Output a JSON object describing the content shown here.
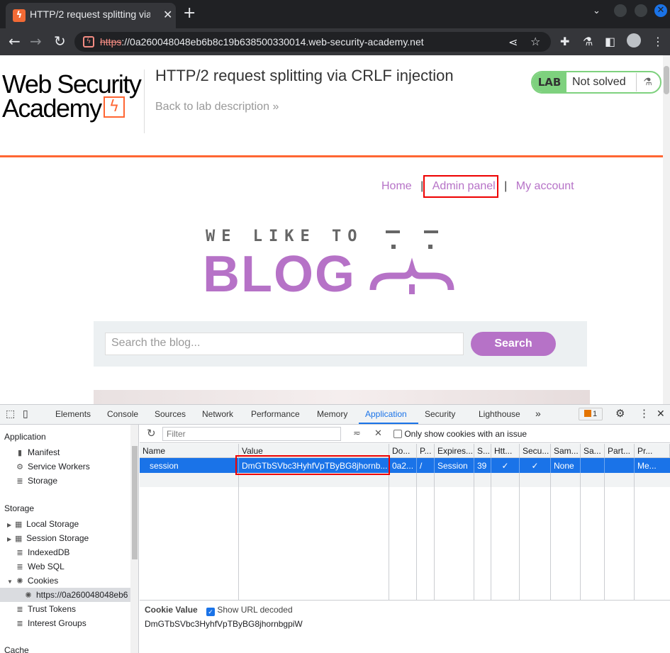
{
  "browser": {
    "tab_title": "HTTP/2 request splitting via CRLF injection",
    "url_scheme": "https",
    "url_rest": "://0a260048048eb6b8c19b638500330014.web-security-academy.net"
  },
  "header": {
    "logo_line1": "Web Security",
    "logo_line2": "Academy",
    "lab_title": "HTTP/2 request splitting via CRLF injection",
    "back_link": "Back to lab description",
    "back_chevrons": "»",
    "lab_badge": "LAB",
    "lab_status": "Not solved"
  },
  "nav": {
    "home": "Home",
    "admin": "Admin panel",
    "account": "My account",
    "separator": "|"
  },
  "blog": {
    "tagline": "WE LIKE TO",
    "word": "BLOG"
  },
  "search": {
    "placeholder": "Search the blog...",
    "button": "Search"
  },
  "devtools": {
    "tabs": [
      "Elements",
      "Console",
      "Sources",
      "Network",
      "Performance",
      "Memory",
      "Application",
      "Security",
      "Lighthouse"
    ],
    "active_tab": "Application",
    "issues_count": "1",
    "sidebar": {
      "application_header": "Application",
      "application_items": [
        "Manifest",
        "Service Workers",
        "Storage"
      ],
      "storage_header": "Storage",
      "storage_items": [
        "Local Storage",
        "Session Storage",
        "IndexedDB",
        "Web SQL",
        "Cookies"
      ],
      "cookie_origin": "https://0a260048048eb6",
      "extra_items": [
        "Trust Tokens",
        "Interest Groups"
      ],
      "cache_header": "Cache"
    },
    "cookies": {
      "filter_placeholder": "Filter",
      "only_issue_label": "Only show cookies with an issue",
      "columns": [
        "Name",
        "Value",
        "Do...",
        "P...",
        "Expires...",
        "S...",
        "Htt...",
        "Secu...",
        "Sam...",
        "Sa...",
        "Part...",
        "Pr..."
      ],
      "row": [
        "session",
        "DmGTbSVbc3HyhfVpTByBG8jhornb...",
        "0a2...",
        "/",
        "Session",
        "39",
        "✓",
        "✓",
        "None",
        "",
        "",
        "Me..."
      ],
      "cookie_value_label": "Cookie Value",
      "show_url_decoded": "Show URL decoded",
      "cookie_value": "DmGTbSVbc3HyhfVpTByBG8jhornbgpiW"
    }
  }
}
